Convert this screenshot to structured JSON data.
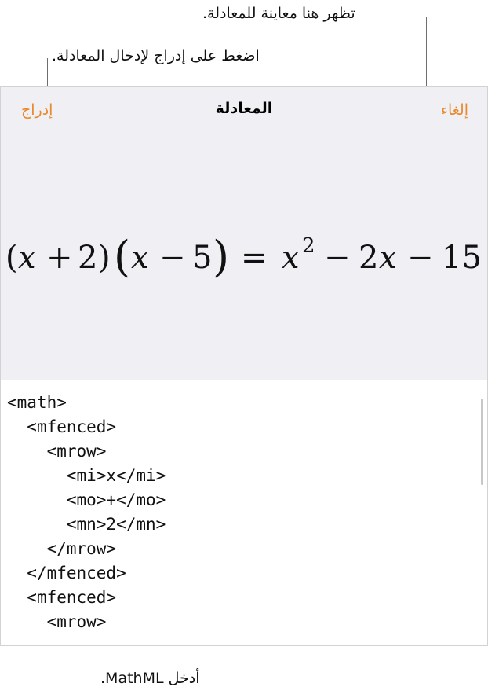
{
  "callouts": {
    "preview_note": "تظهر هنا معاينة للمعادلة.",
    "insert_note": "اضغط على إدراج لإدخال المعادلة.",
    "mathml_note": "أدخل MathML."
  },
  "dialog": {
    "title": "المعادلة",
    "cancel_label": "إلغاء",
    "insert_label": "إدراج",
    "accent_color": "#e8892b",
    "preview_background": "#efeff4"
  },
  "equation": {
    "left": [
      "(",
      "x",
      "+",
      "2",
      ")",
      "(",
      "x",
      "−",
      "5",
      ")"
    ],
    "equals": "=",
    "right": [
      "x",
      "2",
      "−",
      "2",
      "x",
      "−",
      "15"
    ]
  },
  "editor": {
    "lines": [
      "<math>",
      "  <mfenced>",
      "    <mrow>",
      "      <mi>x</mi>",
      "      <mo>+</mo>",
      "      <mn>2</mn>",
      "    </mrow>",
      "  </mfenced>",
      "  <mfenced>",
      "    <mrow>"
    ]
  }
}
